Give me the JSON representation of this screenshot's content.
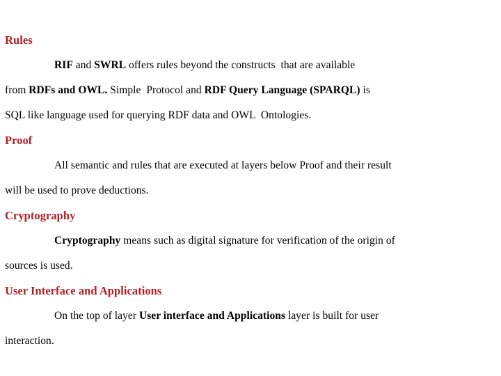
{
  "document": {
    "accent_color": "#b51f24",
    "text_color": "#000000",
    "background_color": "#ffffff",
    "blocks": [
      {
        "id": "rules",
        "heading": "Rules",
        "lines": [
          {
            "indent": true,
            "runs": [
              {
                "text": "RIF",
                "bold": true
              },
              {
                "text": " and ",
                "bold": false
              },
              {
                "text": "SWRL",
                "bold": true
              },
              {
                "text": " offers rules beyond the constructs  that are available",
                "bold": false
              }
            ]
          },
          {
            "indent": false,
            "runs": [
              {
                "text": "from ",
                "bold": false
              },
              {
                "text": "RDFs and OWL.",
                "bold": true
              },
              {
                "text": " Simple  Protocol and ",
                "bold": false
              },
              {
                "text": "RDF Query Language (SPARQL)",
                "bold": true
              },
              {
                "text": " is",
                "bold": false
              }
            ]
          },
          {
            "indent": false,
            "runs": [
              {
                "text": "SQL like language used for querying RDF data and OWL  Ontologies.",
                "bold": false
              }
            ]
          }
        ]
      },
      {
        "id": "proof",
        "heading": "Proof",
        "lines": [
          {
            "indent": true,
            "runs": [
              {
                "text": "All semantic and rules that are executed at layers below Proof and their result",
                "bold": false
              }
            ]
          },
          {
            "indent": false,
            "runs": [
              {
                "text": "will be used to prove deductions.",
                "bold": false
              }
            ]
          }
        ]
      },
      {
        "id": "cryptography",
        "heading": "Cryptography",
        "lines": [
          {
            "indent": true,
            "runs": [
              {
                "text": "Cryptography",
                "bold": true
              },
              {
                "text": " means such as digital signature for verification of the origin of",
                "bold": false
              }
            ]
          },
          {
            "indent": false,
            "runs": [
              {
                "text": "sources is used.",
                "bold": false
              }
            ]
          }
        ]
      },
      {
        "id": "user-interface-and-applications",
        "heading": "User Interface and Applications",
        "lines": [
          {
            "indent": true,
            "runs": [
              {
                "text": "On the top of layer ",
                "bold": false
              },
              {
                "text": "User interface and Applications",
                "bold": true
              },
              {
                "text": " layer is built for user",
                "bold": false
              }
            ]
          },
          {
            "indent": false,
            "runs": [
              {
                "text": "interaction.",
                "bold": false
              }
            ]
          }
        ]
      }
    ]
  }
}
